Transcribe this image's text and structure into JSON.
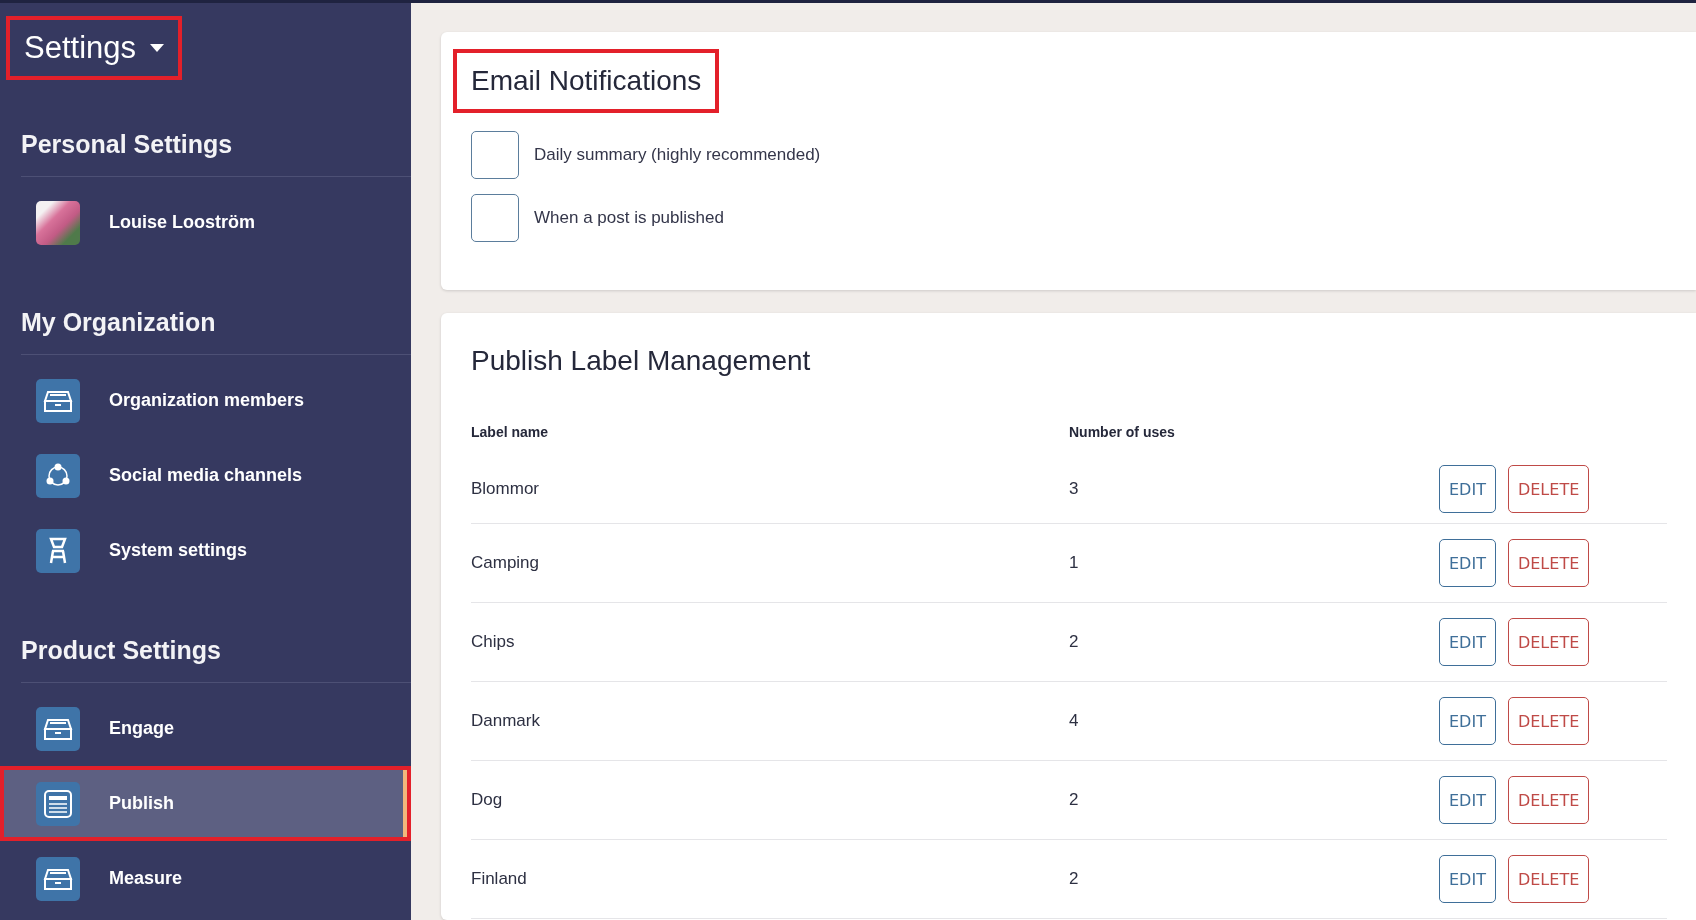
{
  "sidebar": {
    "title": {
      "text": "Settings",
      "annotated": true
    },
    "sections": [
      {
        "heading": "Personal Settings",
        "items": [
          {
            "label": "Louise Looström",
            "kind": "avatar",
            "selected": false,
            "annotated": false
          }
        ]
      },
      {
        "heading": "My Organization",
        "items": [
          {
            "label": "Organization members",
            "kind": "tray",
            "selected": false,
            "annotated": false
          },
          {
            "label": "Social media channels",
            "kind": "network",
            "selected": false,
            "annotated": false
          },
          {
            "label": "System settings",
            "kind": "chair",
            "selected": false,
            "annotated": false
          }
        ]
      },
      {
        "heading": "Product Settings",
        "items": [
          {
            "label": "Engage",
            "kind": "tray",
            "selected": false,
            "annotated": false
          },
          {
            "label": "Publish",
            "kind": "document",
            "selected": true,
            "annotated": true
          },
          {
            "label": "Measure",
            "kind": "tray",
            "selected": false,
            "annotated": false
          }
        ]
      }
    ]
  },
  "email_notifications": {
    "heading": "Email Notifications",
    "annotated": true,
    "options": [
      {
        "label": "Daily summary (highly recommended)",
        "checked": false
      },
      {
        "label": "When a post is published",
        "checked": false
      }
    ]
  },
  "label_management": {
    "heading": "Publish Label Management",
    "columns": [
      "Label name",
      "Number of uses"
    ],
    "rows": [
      {
        "name": "Blommor",
        "uses": "3",
        "edit": "EDIT",
        "delete": "DELETE"
      },
      {
        "name": "Camping",
        "uses": "1",
        "edit": "EDIT",
        "delete": "DELETE"
      },
      {
        "name": "Chips",
        "uses": "2",
        "edit": "EDIT",
        "delete": "DELETE"
      },
      {
        "name": "Danmark",
        "uses": "4",
        "edit": "EDIT",
        "delete": "DELETE"
      },
      {
        "name": "Dog",
        "uses": "2",
        "edit": "EDIT",
        "delete": "DELETE"
      },
      {
        "name": "Finland",
        "uses": "2",
        "edit": "EDIT",
        "delete": "DELETE"
      }
    ]
  }
}
